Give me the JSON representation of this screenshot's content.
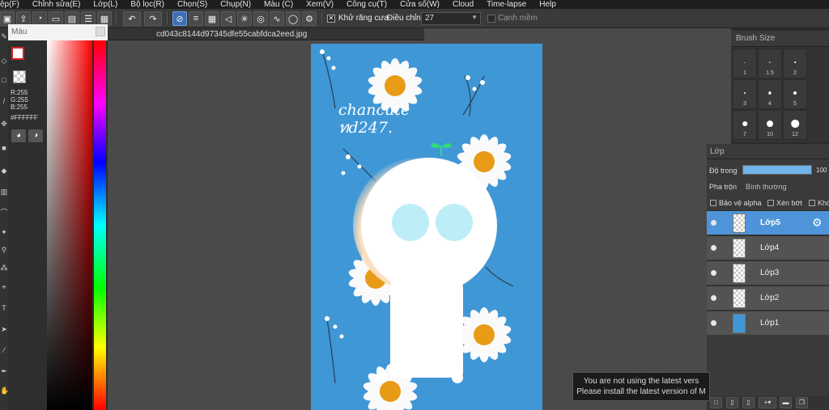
{
  "menu": [
    "ệp(F)",
    "Chỉnh sửa(E)",
    "Lớp(L)",
    "Bộ lọc(R)",
    "Chọn(S)",
    "Chụp(N)",
    "Màu (C)",
    "Xem(V)",
    "Công cụ(T)",
    "Cửa sổ(W)",
    "Cloud",
    "Time-lapse",
    "Help"
  ],
  "toolbar": {
    "antialias_label": "Khử răng cưa",
    "antialias_checked": "✕",
    "adjust_label": "Điều chỉnh",
    "adjust_value": "27",
    "smooth_label": "Cạnh mềm"
  },
  "color_panel": {
    "title": "Màu",
    "rgb": "R:255\nG:255\nB:255",
    "hex": "#FFFFFF",
    "fg_color": "#FFFFFF"
  },
  "document": {
    "tab_title": "cd043c8144d97345dfe55cabfdca2eed.jpg",
    "handwriting_line1": "chancute",
    "handwriting_line2": "ทd247."
  },
  "brush_panel": {
    "title": "Brush Size",
    "sizes": [
      "1",
      "1.5",
      "2",
      "3",
      "4",
      "5",
      "7",
      "10",
      "12"
    ]
  },
  "layer_panel": {
    "title": "Lớp",
    "opacity_label": "Độ trong",
    "opacity_value": "100",
    "opacity_fraction": 1.0,
    "blend_label": "Pha trộn",
    "blend_value": "Bình thường",
    "opt_protect_alpha": "Bảo vệ alpha",
    "opt_clipping": "Xén bớt",
    "opt_lock": "Khó",
    "layers": [
      "Lớp5",
      "Lớp4",
      "Lớp3",
      "Lớp2",
      "Lớp1"
    ]
  },
  "notice": {
    "line1": "You are not using the latest vers",
    "line2": "Please install the latest version of M"
  }
}
